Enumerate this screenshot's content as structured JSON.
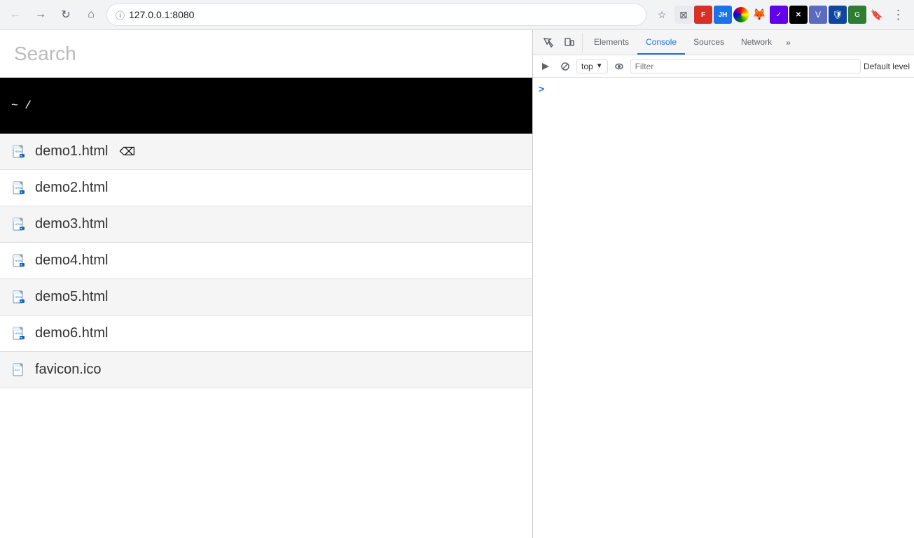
{
  "browser": {
    "url": "127.0.0.1:8080",
    "back_disabled": true,
    "forward_disabled": false
  },
  "page": {
    "search_placeholder": "Search",
    "terminal_prompt": "~ /",
    "files": [
      {
        "name": "demo1.html",
        "type": "html"
      },
      {
        "name": "demo2.html",
        "type": "html"
      },
      {
        "name": "demo3.html",
        "type": "html"
      },
      {
        "name": "demo4.html",
        "type": "html"
      },
      {
        "name": "demo5.html",
        "type": "html"
      },
      {
        "name": "demo6.html",
        "type": "html"
      },
      {
        "name": "favicon.ico",
        "type": "ico"
      }
    ]
  },
  "devtools": {
    "tabs": [
      {
        "id": "elements",
        "label": "Elements"
      },
      {
        "id": "console",
        "label": "Console"
      },
      {
        "id": "sources",
        "label": "Sources"
      },
      {
        "id": "network",
        "label": "Network"
      }
    ],
    "active_tab": "console",
    "more_label": "»",
    "console_context": "top",
    "filter_placeholder": "Filter",
    "default_level": "Default level",
    "console_prompt_symbol": ">"
  }
}
